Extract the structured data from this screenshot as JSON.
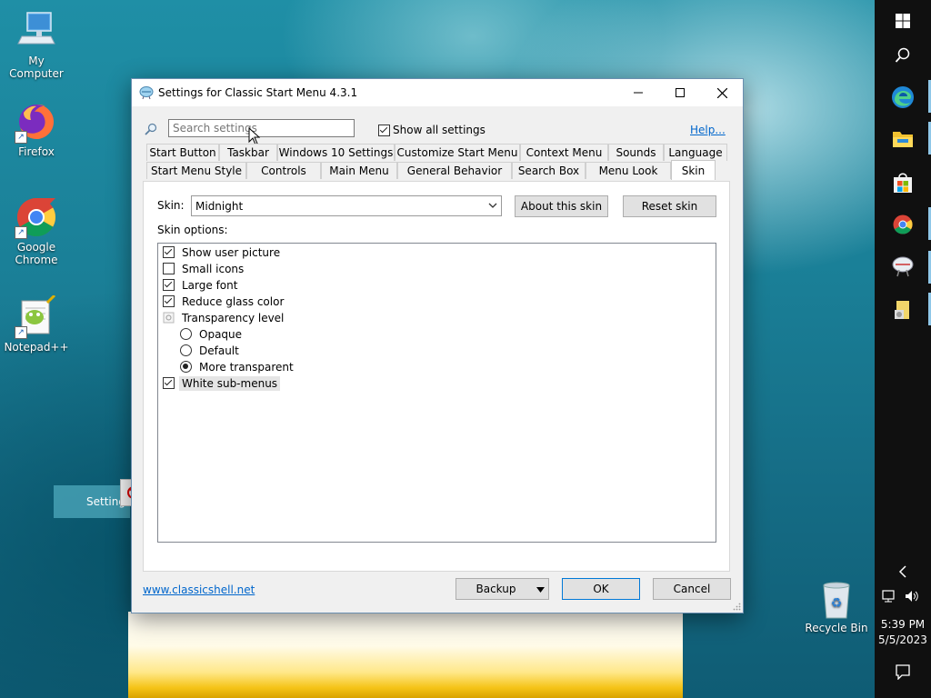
{
  "desktop": {
    "icons": [
      {
        "label": "My Computer"
      },
      {
        "label": "Firefox"
      },
      {
        "label": "Google Chrome"
      },
      {
        "label": "Notepad++"
      },
      {
        "label": "Recycle Bin"
      }
    ],
    "drag_ghost_label": "Setting"
  },
  "taskbar": {
    "clock_time": "5:39 PM",
    "clock_date": "5/5/2023",
    "icons": [
      "windows-start-icon",
      "search-icon",
      "edge-icon",
      "file-explorer-icon",
      "store-icon",
      "chrome-icon",
      "classic-shell-icon",
      "folder-icon"
    ]
  },
  "dialog": {
    "title": "Settings for Classic Start Menu 4.3.1",
    "search_placeholder": "Search settings",
    "show_all_label": "Show all settings",
    "show_all_checked": true,
    "help_link": "Help...",
    "tabs_row1": [
      "Start Button",
      "Taskbar",
      "Windows 10 Settings",
      "Customize Start Menu",
      "Context Menu",
      "Sounds",
      "Language"
    ],
    "tabs_row2": [
      "Start Menu Style",
      "Controls",
      "Main Menu",
      "General Behavior",
      "Search Box",
      "Menu Look",
      "Skin"
    ],
    "active_tab": "Skin",
    "skin_label": "Skin:",
    "skin_value": "Midnight",
    "about_skin_button": "About this skin",
    "reset_skin_button": "Reset skin",
    "skin_options_label": "Skin options:",
    "options": [
      {
        "label": "Show user picture",
        "kind": "checkbox",
        "checked": true
      },
      {
        "label": "Small icons",
        "kind": "checkbox",
        "checked": false
      },
      {
        "label": "Large font",
        "kind": "checkbox",
        "checked": true
      },
      {
        "label": "Reduce glass color",
        "kind": "checkbox",
        "checked": true
      },
      {
        "label": "Transparency level",
        "kind": "group"
      },
      {
        "label": "Opaque",
        "kind": "radio",
        "checked": false
      },
      {
        "label": "Default",
        "kind": "radio",
        "checked": false
      },
      {
        "label": "More transparent",
        "kind": "radio",
        "checked": true
      },
      {
        "label": "White sub-menus",
        "kind": "checkbox",
        "checked": true
      }
    ],
    "website_link": "www.classicshell.net",
    "backup_button": "Backup",
    "ok_button": "OK",
    "cancel_button": "Cancel"
  }
}
